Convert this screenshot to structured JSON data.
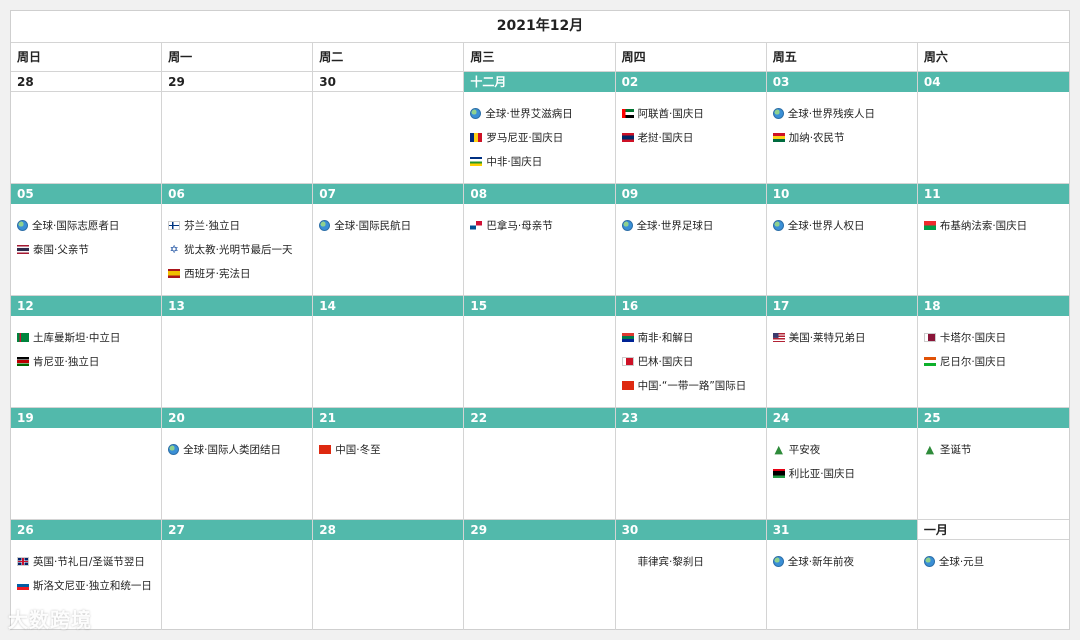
{
  "title": "2021年12月",
  "weekdays": [
    "周日",
    "周一",
    "周二",
    "周三",
    "周四",
    "周五",
    "周六"
  ],
  "weeks": [
    [
      {
        "label": "28",
        "in_month": false,
        "events": []
      },
      {
        "label": "29",
        "in_month": false,
        "events": []
      },
      {
        "label": "30",
        "in_month": false,
        "events": []
      },
      {
        "label": "十二月",
        "in_month": true,
        "events": [
          {
            "icon": "globe",
            "text": "全球·世界艾滋病日"
          },
          {
            "icon": "flag-romania",
            "text": "罗马尼亚·国庆日"
          },
          {
            "icon": "flag-central-african-republic",
            "text": "中非·国庆日"
          }
        ]
      },
      {
        "label": "02",
        "in_month": true,
        "events": [
          {
            "icon": "flag-uae",
            "text": "阿联酋·国庆日"
          },
          {
            "icon": "flag-laos",
            "text": "老挝·国庆日"
          }
        ]
      },
      {
        "label": "03",
        "in_month": true,
        "events": [
          {
            "icon": "globe",
            "text": "全球·世界残疾人日"
          },
          {
            "icon": "flag-ghana",
            "text": "加纳·农民节"
          }
        ]
      },
      {
        "label": "04",
        "in_month": true,
        "events": []
      }
    ],
    [
      {
        "label": "05",
        "in_month": true,
        "events": [
          {
            "icon": "globe",
            "text": "全球·国际志愿者日"
          },
          {
            "icon": "flag-thailand",
            "text": "泰国·父亲节"
          }
        ]
      },
      {
        "label": "06",
        "in_month": true,
        "events": [
          {
            "icon": "flag-finland",
            "text": "芬兰·独立日"
          },
          {
            "icon": "star-of-david",
            "text": "犹太教·光明节最后一天"
          },
          {
            "icon": "flag-spain",
            "text": "西班牙·宪法日"
          }
        ]
      },
      {
        "label": "07",
        "in_month": true,
        "events": [
          {
            "icon": "globe",
            "text": "全球·国际民航日"
          }
        ]
      },
      {
        "label": "08",
        "in_month": true,
        "events": [
          {
            "icon": "flag-panama",
            "text": "巴拿马·母亲节"
          }
        ]
      },
      {
        "label": "09",
        "in_month": true,
        "events": [
          {
            "icon": "globe",
            "text": "全球·世界足球日"
          }
        ]
      },
      {
        "label": "10",
        "in_month": true,
        "events": [
          {
            "icon": "globe",
            "text": "全球·世界人权日"
          }
        ]
      },
      {
        "label": "11",
        "in_month": true,
        "events": [
          {
            "icon": "flag-burkina-faso",
            "text": "布基纳法索·国庆日"
          }
        ]
      }
    ],
    [
      {
        "label": "12",
        "in_month": true,
        "events": [
          {
            "icon": "flag-turkmenistan",
            "text": "土库曼斯坦·中立日"
          },
          {
            "icon": "flag-kenya",
            "text": "肯尼亚·独立日"
          }
        ]
      },
      {
        "label": "13",
        "in_month": true,
        "events": []
      },
      {
        "label": "14",
        "in_month": true,
        "events": []
      },
      {
        "label": "15",
        "in_month": true,
        "events": []
      },
      {
        "label": "16",
        "in_month": true,
        "events": [
          {
            "icon": "flag-south-africa",
            "text": "南非·和解日"
          },
          {
            "icon": "flag-bahrain",
            "text": "巴林·国庆日"
          },
          {
            "icon": "flag-china",
            "text": "中国·“一带一路”国际日"
          }
        ]
      },
      {
        "label": "17",
        "in_month": true,
        "events": [
          {
            "icon": "flag-usa",
            "text": "美国·莱特兄弟日"
          }
        ]
      },
      {
        "label": "18",
        "in_month": true,
        "events": [
          {
            "icon": "flag-qatar",
            "text": "卡塔尔·国庆日"
          },
          {
            "icon": "flag-niger",
            "text": "尼日尔·国庆日"
          }
        ]
      }
    ],
    [
      {
        "label": "19",
        "in_month": true,
        "events": []
      },
      {
        "label": "20",
        "in_month": true,
        "events": [
          {
            "icon": "globe",
            "text": "全球·国际人类团结日"
          }
        ]
      },
      {
        "label": "21",
        "in_month": true,
        "events": [
          {
            "icon": "flag-china",
            "text": "中国·冬至"
          }
        ]
      },
      {
        "label": "22",
        "in_month": true,
        "events": []
      },
      {
        "label": "23",
        "in_month": true,
        "events": []
      },
      {
        "label": "24",
        "in_month": true,
        "events": [
          {
            "icon": "christmas-tree",
            "text": "平安夜"
          },
          {
            "icon": "flag-libya",
            "text": "利比亚·国庆日"
          }
        ]
      },
      {
        "label": "25",
        "in_month": true,
        "events": [
          {
            "icon": "christmas-tree",
            "text": "圣诞节"
          }
        ]
      }
    ],
    [
      {
        "label": "26",
        "in_month": true,
        "events": [
          {
            "icon": "flag-uk",
            "text": "英国·节礼日/圣诞节翌日"
          },
          {
            "icon": "flag-slovenia",
            "text": "斯洛文尼亚·独立和统一日"
          }
        ]
      },
      {
        "label": "27",
        "in_month": true,
        "events": []
      },
      {
        "label": "28",
        "in_month": true,
        "events": []
      },
      {
        "label": "29",
        "in_month": true,
        "events": []
      },
      {
        "label": "30",
        "in_month": true,
        "events": [
          {
            "icon": "flag-philippines",
            "text": "菲律宾·黎刹日"
          }
        ]
      },
      {
        "label": "31",
        "in_month": true,
        "events": [
          {
            "icon": "globe",
            "text": "全球·新年前夜"
          }
        ]
      },
      {
        "label": "一月",
        "in_month": false,
        "events": [
          {
            "icon": "globe",
            "text": "全球·元旦"
          }
        ]
      }
    ]
  ],
  "watermark": "大数跨境",
  "colors": {
    "header_bg": "#52b9ab",
    "border": "#d4d4d4",
    "page_bg": "#f1f1f1"
  }
}
